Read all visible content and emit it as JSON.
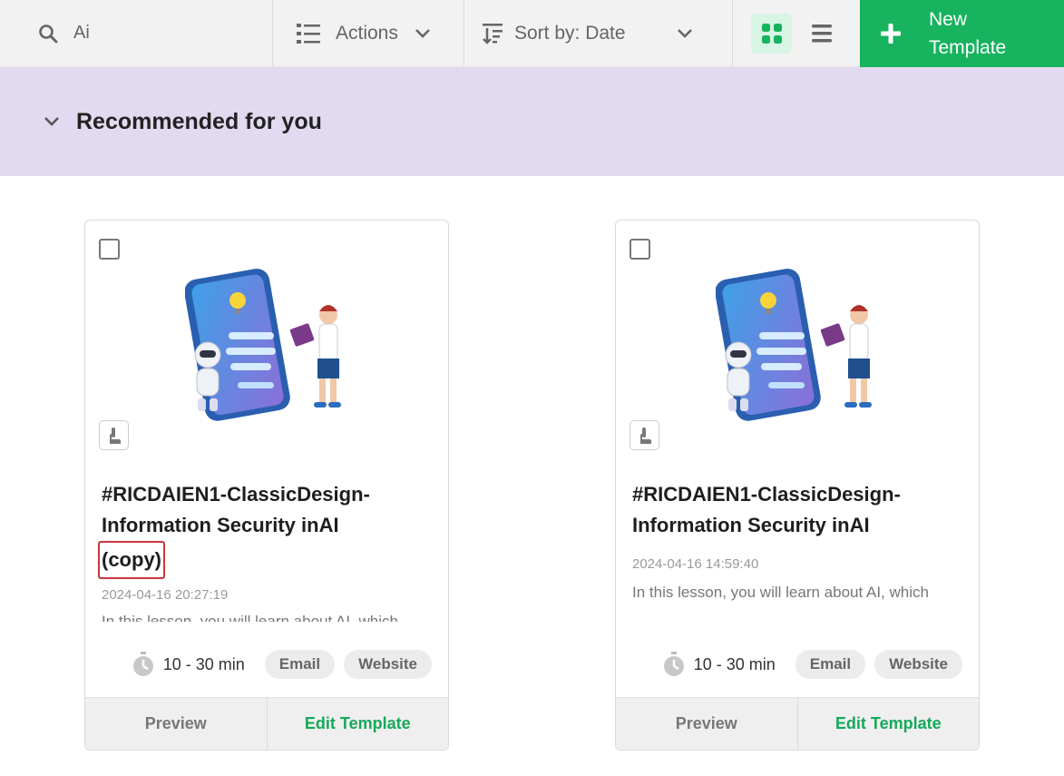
{
  "toolbar": {
    "search_value": "Ai",
    "actions_label": "Actions",
    "sort_label": "Sort by: Date",
    "new_template_label": "New Template"
  },
  "section": {
    "title": "Recommended for you"
  },
  "cards": [
    {
      "title": "#RICDAIEN1-ClassicDesign-Information Security inAI",
      "copy_tag": "(copy)",
      "date": "2024-04-16 20:27:19",
      "description": "In this lesson, you will learn about AI, which",
      "duration": "10 - 30 min",
      "tags": [
        "Email",
        "Website"
      ],
      "preview_label": "Preview",
      "edit_label": "Edit Template"
    },
    {
      "title": "#RICDAIEN1-ClassicDesign-Information Security inAI",
      "date": "2024-04-16 14:59:40",
      "description": "In this lesson, you will learn about AI, which",
      "duration": "10 - 30 min",
      "tags": [
        "Email",
        "Website"
      ],
      "preview_label": "Preview",
      "edit_label": "Edit Template"
    }
  ],
  "colors": {
    "accent": "#17b35f",
    "band": "#e2daf0",
    "highlight": "#c9373d"
  }
}
